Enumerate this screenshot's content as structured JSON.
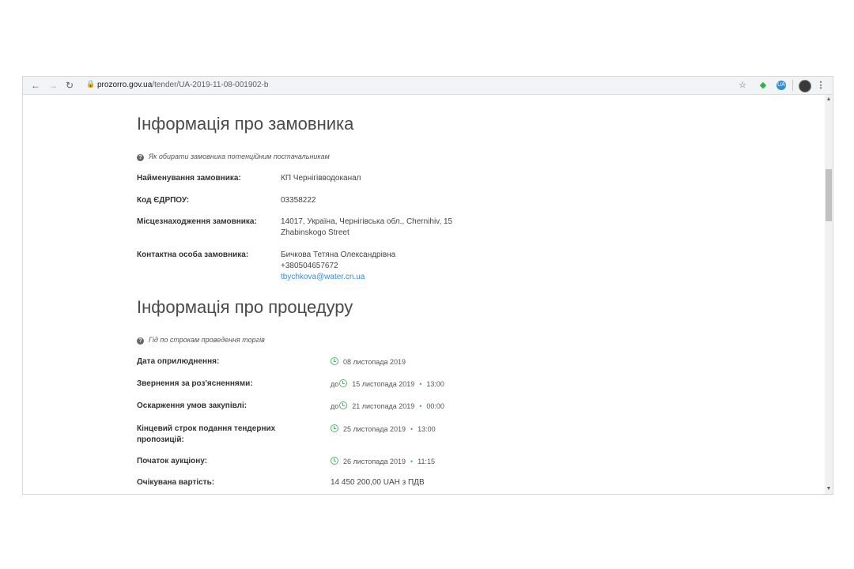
{
  "browser": {
    "url_host": "prozorro.gov.ua",
    "url_path": "/tender/UA-2019-11-08-001902-b"
  },
  "customer": {
    "title": "Інформація про замовника",
    "help": "Як обирати замовника потенційним постачальникам",
    "name_label": "Найменування замовника:",
    "name_value": "КП Чернігівводоканал",
    "edrpou_label": "Код ЄДРПОУ:",
    "edrpou_value": "03358222",
    "location_label": "Місцезнаходження замовника:",
    "location_line1": "14017, Україна, Чернігівська обл., Chernihiv, 15",
    "location_line2": "Zhabinskogo Street",
    "contact_label": "Контактна особа замовника:",
    "contact_name": "Бичкова Тетяна Олександрівна",
    "contact_phone": "+380504657672",
    "contact_email": "tbychkova@water.cn.ua"
  },
  "procedure": {
    "title": "Інформація про процедуру",
    "help": "Гід по строкам проведення торгів",
    "rows": [
      {
        "label": "Дата оприлюднення:",
        "prefix": "",
        "date": "08 листопада 2019",
        "time": ""
      },
      {
        "label": "Звернення за роз'ясненнями:",
        "prefix": "до",
        "date": "15 листопада 2019",
        "time": "13:00"
      },
      {
        "label": "Оскарження умов закупівлі:",
        "prefix": "до",
        "date": "21 листопада 2019",
        "time": "00:00"
      },
      {
        "label": "Кінцевий строк подання тендерних",
        "label2": "пропозицій:",
        "prefix": "",
        "date": "25 листопада 2019",
        "time": "13:00"
      },
      {
        "label": "Початок аукціону:",
        "prefix": "",
        "date": "26 листопада 2019",
        "time": "11:15"
      }
    ],
    "expected_label": "Очікувана вартість:",
    "expected_value": "14 450 200,00 UAH з ПДВ"
  }
}
